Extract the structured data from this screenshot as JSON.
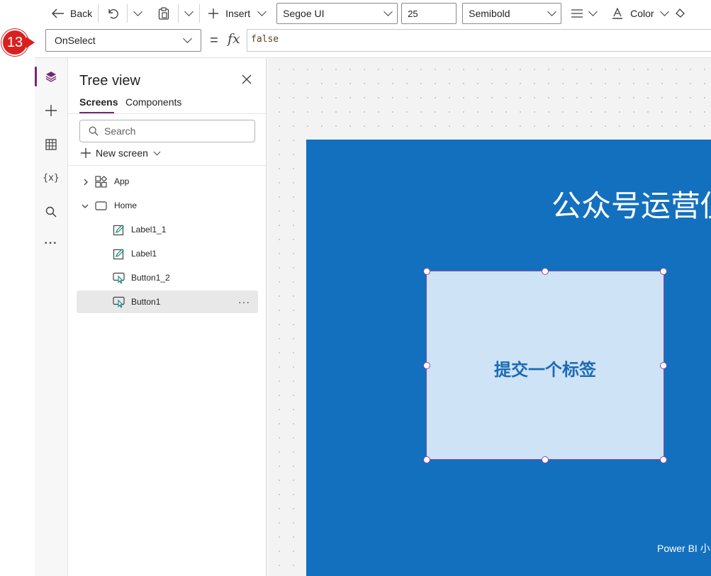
{
  "toolbar": {
    "back_label": "Back",
    "insert_label": "Insert",
    "font_family": "Segoe UI",
    "font_size": "25",
    "font_weight": "Semibold",
    "color_label": "Color"
  },
  "step_badge": "13",
  "formula_bar": {
    "property": "OnSelect",
    "equals": "=",
    "fx": "fx",
    "formula": "false"
  },
  "rail": {
    "items": [
      "tree-view-icon",
      "insert-icon",
      "data-icon",
      "variables-icon",
      "search-icon",
      "more-icon"
    ],
    "variables_glyph": "{x}",
    "more_glyph": "···"
  },
  "tree_view": {
    "title": "Tree view",
    "tabs": [
      "Screens",
      "Components"
    ],
    "search_placeholder": "Search",
    "new_screen_label": "New screen",
    "items": [
      {
        "label": "App",
        "type": "app"
      },
      {
        "label": "Home",
        "type": "screen"
      },
      {
        "label": "Label1_1",
        "type": "label"
      },
      {
        "label": "Label1",
        "type": "label"
      },
      {
        "label": "Button1_2",
        "type": "button"
      },
      {
        "label": "Button1",
        "type": "button",
        "selected": true
      }
    ],
    "row_more": "···"
  },
  "canvas": {
    "screen_title": "公众号运营仪",
    "button_text": "提交一个标签",
    "footer_text": "Power BI 小",
    "colors": {
      "screen_background": "#1370BF",
      "button_fill": "#CFE3F6",
      "button_text": "#1A6AB3",
      "selection": "#8B4A9E"
    }
  }
}
